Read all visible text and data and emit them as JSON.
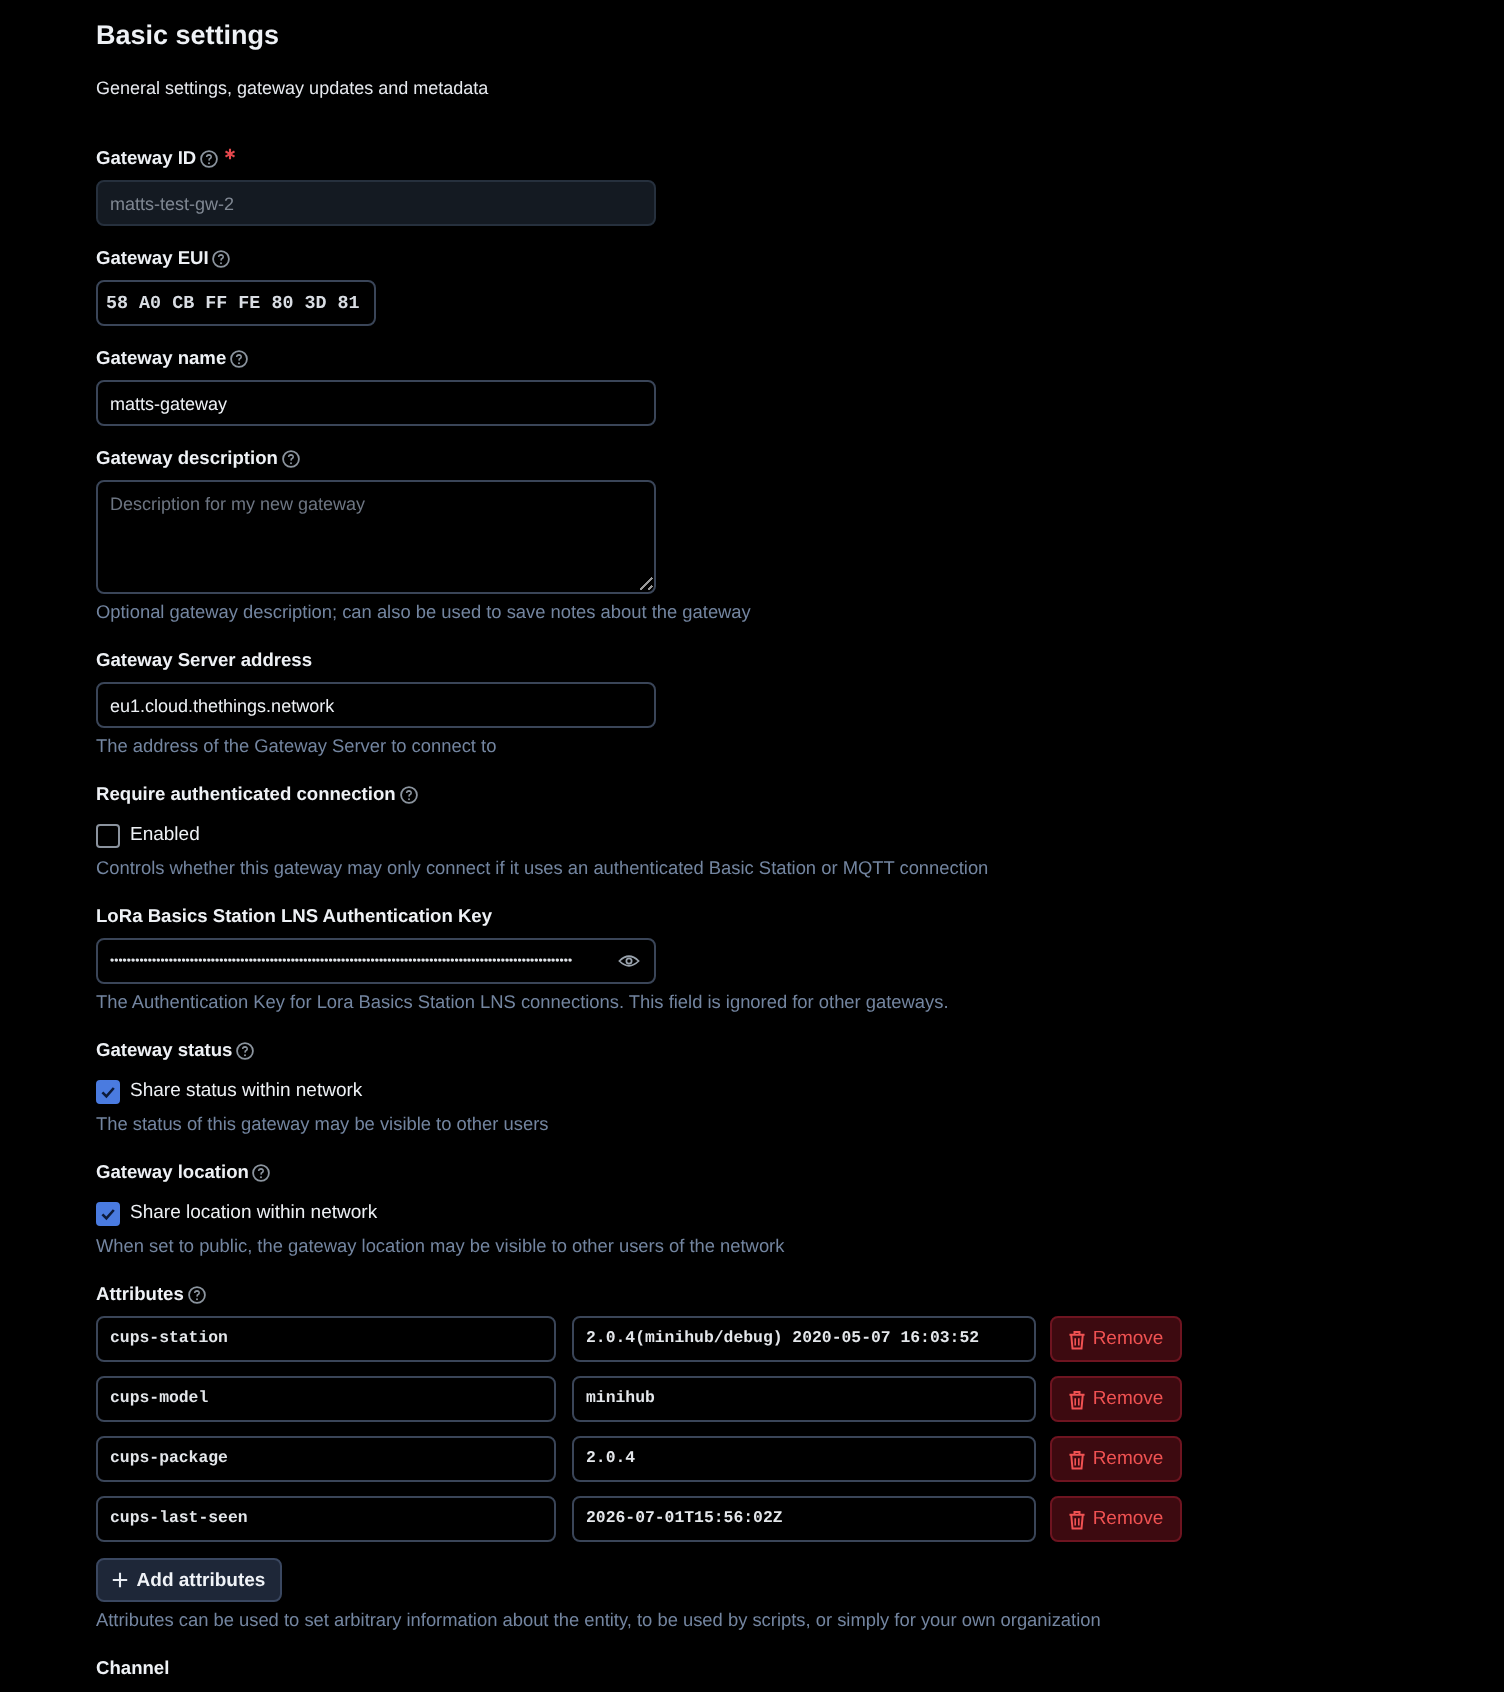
{
  "section": {
    "title": "Basic settings",
    "subtitle": "General settings, gateway updates and metadata"
  },
  "fields": [
    {
      "kind": "text",
      "label": "Gateway ID",
      "help_icon": true,
      "required": true,
      "disabled": true,
      "value": "matts-test-gw-2"
    },
    {
      "kind": "eui",
      "label": "Gateway EUI",
      "help_icon": true,
      "required": false,
      "disabled": false,
      "value": "58 A0 CB FF FE 80 3D 81"
    },
    {
      "kind": "text",
      "label": "Gateway name",
      "help_icon": true,
      "required": false,
      "disabled": false,
      "value": "matts-gateway"
    },
    {
      "kind": "textarea",
      "label": "Gateway description",
      "help_icon": true,
      "required": false,
      "disabled": false,
      "placeholder": "Description for my new gateway",
      "description": "Optional gateway description; can also be used to save notes about the gateway"
    },
    {
      "kind": "text",
      "label": "Gateway Server address",
      "help_icon": false,
      "required": false,
      "disabled": false,
      "value": "eu1.cloud.thethings.network",
      "description": "The address of the Gateway Server to connect to"
    },
    {
      "kind": "checkbox",
      "label": "Require authenticated connection",
      "help_icon": true,
      "required": false,
      "option": "Enabled",
      "checked": false,
      "description": "Controls whether this gateway may only connect if it uses an authenticated Basic Station or MQTT connection"
    },
    {
      "kind": "password",
      "label": "LoRa Basics Station LNS Authentication Key",
      "help_icon": false,
      "required": false,
      "disabled": false,
      "masked_value": "••••••••••••••••••••••••••••••••••••••••••••••••••••••••••••••••••••••••••••••••••••••••••••••••••••••••••••••",
      "description": "The Authentication Key for Lora Basics Station LNS connections. This field is ignored for other gateways."
    },
    {
      "kind": "checkbox",
      "label": "Gateway status",
      "help_icon": true,
      "required": false,
      "option": "Share status within network",
      "checked": true,
      "description": "The status of this gateway may be visible to other users"
    },
    {
      "kind": "checkbox",
      "label": "Gateway location",
      "help_icon": true,
      "required": false,
      "option": "Share location within network",
      "checked": true,
      "description": "When set to public, the gateway location may be visible to other users of the network"
    },
    {
      "kind": "attributes",
      "label": "Attributes",
      "help_icon": true,
      "required": false,
      "rows": [
        {
          "key": "cups-station",
          "value": "2.0.4(minihub/debug) 2020-05-07 16:03:52",
          "remove_label": "Remove"
        },
        {
          "key": "cups-model",
          "value": "minihub",
          "remove_label": "Remove"
        },
        {
          "key": "cups-package",
          "value": "2.0.4",
          "remove_label": "Remove"
        },
        {
          "key": "cups-last-seen",
          "value": "2026-07-01T15:56:02Z",
          "remove_label": "Remove"
        }
      ],
      "add_label": "Add attributes",
      "description": "Attributes can be used to set arbitrary information about the entity, to be used by scripts, or simply for your own organization"
    },
    {
      "kind": "label_only",
      "label": "Channel",
      "help_icon": false,
      "required": false
    }
  ]
}
